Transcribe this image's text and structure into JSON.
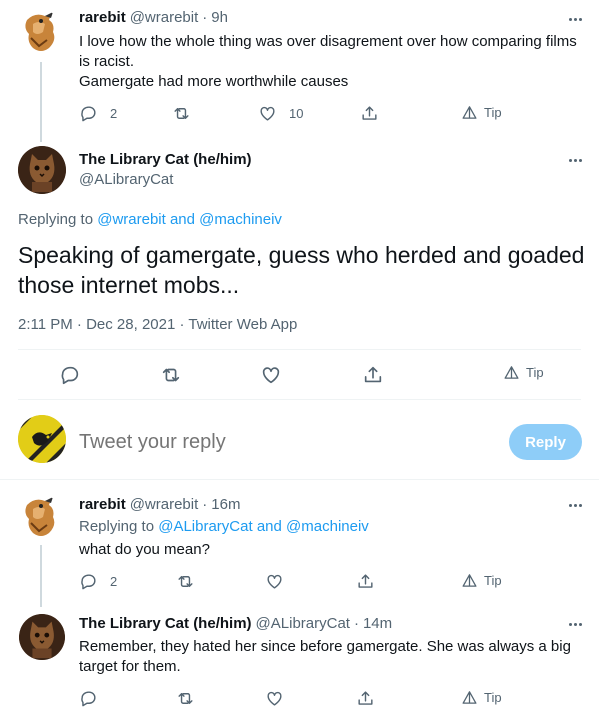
{
  "tweet1": {
    "name": "rarebit",
    "handle": "@wrarebit",
    "sep": "·",
    "time": "9h",
    "lines": [
      "I love how the whole thing was over disagrement over how comparing films",
      "is racist.",
      "Gamergate had more worthwhile causes"
    ],
    "replies": "2",
    "likes": "10",
    "tip": "Tip"
  },
  "main": {
    "name": "The Library Cat (he/him)",
    "handle": "@ALibraryCat",
    "replying_prefix": "Replying to",
    "replying_user1": "@wrarebit",
    "replying_and": "and",
    "replying_user2": "@machineiv",
    "text_line1": "Speaking of gamergate, guess who herded and goaded",
    "text_line2": "those internet mobs...",
    "timestamp": "2:11 PM · Dec 28, 2021 · Twitter Web App",
    "tip": "Tip"
  },
  "composer": {
    "placeholder": "Tweet your reply",
    "button": "Reply"
  },
  "reply1": {
    "name": "rarebit",
    "handle": "@wrarebit",
    "sep": "·",
    "time": "16m",
    "replying_prefix": "Replying to",
    "replying_user1": "@ALibraryCat",
    "replying_and": "and",
    "replying_user2": "@machineiv",
    "text": "what do you mean?",
    "replies": "2",
    "tip": "Tip"
  },
  "reply2": {
    "name": "The Library Cat (he/him)",
    "handle": "@ALibraryCat",
    "sep": "·",
    "time": "14m",
    "lines": [
      "Remember, they hated her since before gamergate. She was always a big",
      "target for them."
    ],
    "tip": "Tip"
  },
  "colors": {
    "accent": "#1d9bf0",
    "reply_button_disabled": "#8ecdf8",
    "muted": "#536471",
    "divider": "#eff3f4"
  }
}
